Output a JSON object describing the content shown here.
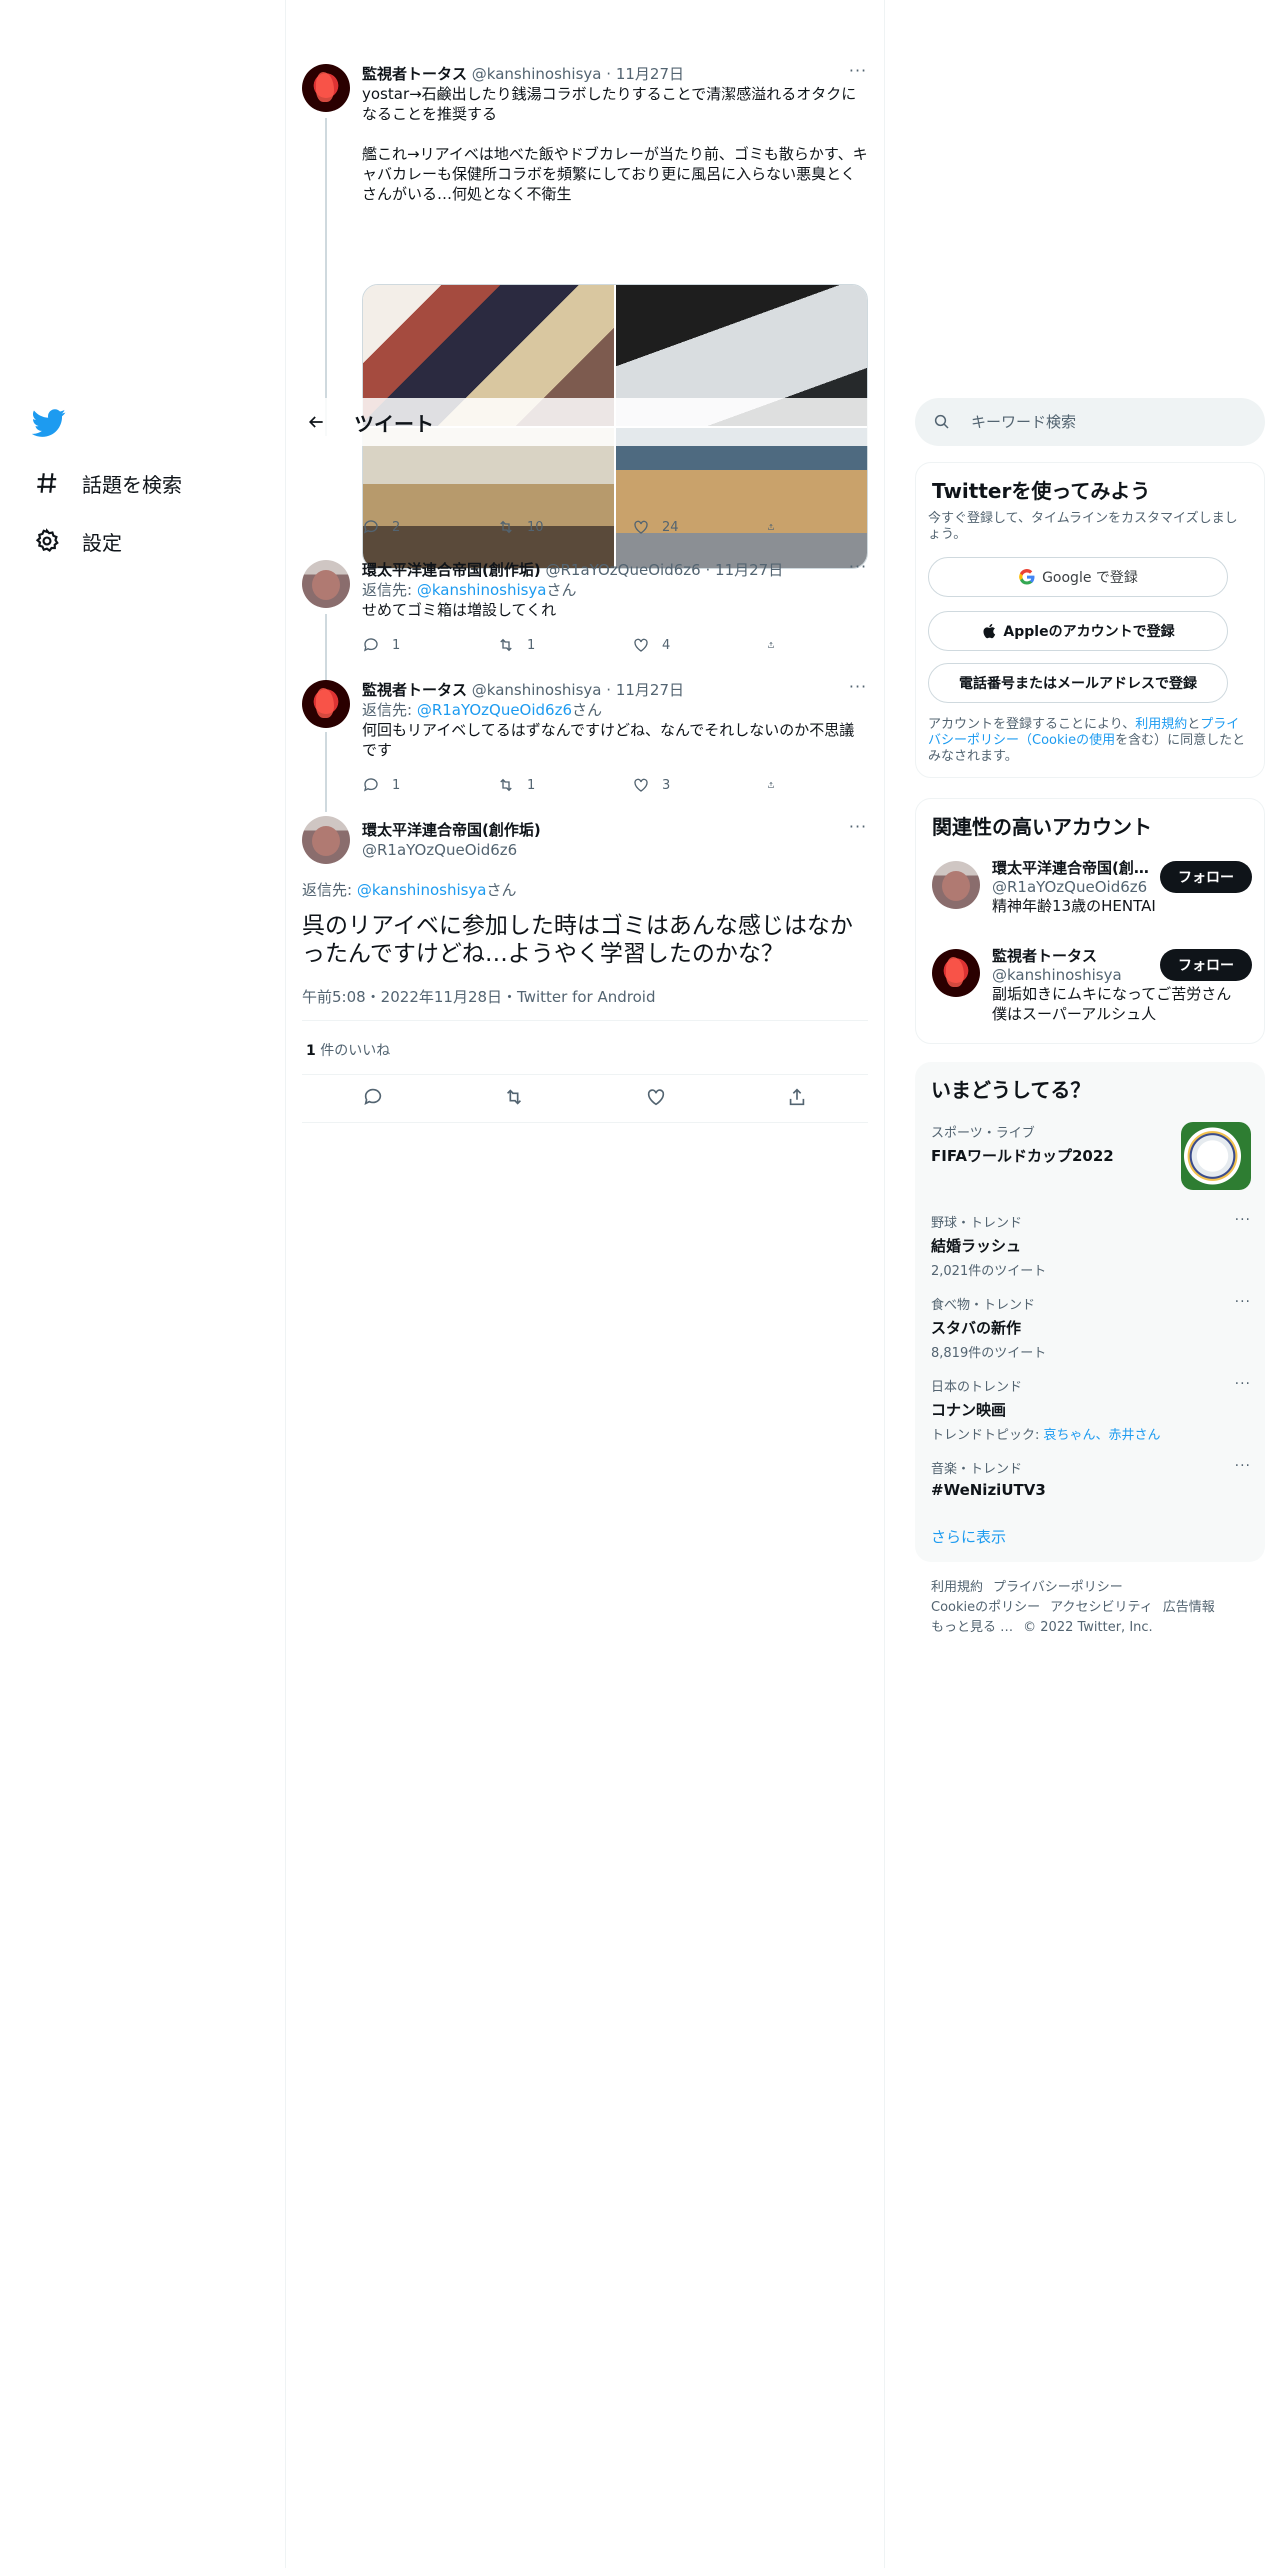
{
  "nav": {
    "logo": "twitter-bird-icon",
    "items": [
      {
        "label": "話題を検索",
        "icon": "hashtag-icon"
      },
      {
        "label": "設定",
        "icon": "gear-icon"
      }
    ]
  },
  "header": {
    "title": "ツイート",
    "back_icon": "arrow-left-icon"
  },
  "tweets": [
    {
      "name": "監視者トータス",
      "handle": "@kanshinoshisya",
      "date": "11月27日",
      "text": "yostar→石鹸出したり銭湯コラボしたりすることで清潔感溢れるオタクになることを推奨する\n\n艦これ→リアイベは地べた飯やドブカレーが当たり前、ゴミも散らかす、キャバカレーも保健所コラボを頻繁にしており更に風呂に入らない悪臭とくさんがいる…何処となく不衛生",
      "replies": "2",
      "retweets": "10",
      "likes": "24"
    },
    {
      "name": "環太平洋連合帝国(創作垢)",
      "handle": "@R1aYOzQueOid6z6",
      "date": "11月27日",
      "reply_prefix": "返信先: ",
      "reply_to": "@kanshinoshisya",
      "reply_suffix": "さん",
      "text": "せめてゴミ箱は増設してくれ",
      "replies": "1",
      "retweets": "1",
      "likes": "4"
    },
    {
      "name": "監視者トータス",
      "handle": "@kanshinoshisya",
      "date": "11月27日",
      "reply_prefix": "返信先: ",
      "reply_to": "@R1aYOzQueOid6z6",
      "reply_suffix": "さん",
      "text": "何回もリアイベしてるはずなんですけどね、なんでそれしないのか不思議です",
      "replies": "1",
      "retweets": "1",
      "likes": "3"
    }
  ],
  "main_tweet": {
    "name": "環太平洋連合帝国(創作垢)",
    "handle": "@R1aYOzQueOid6z6",
    "reply_prefix": "返信先: ",
    "reply_to": "@kanshinoshisya",
    "reply_suffix": "さん",
    "text": "呉のリアイベに参加した時はゴミはあんな感じはなかったんですけどね…ようやく学習したのかな？",
    "timestamp": "午前5:08・2022年11月28日・Twitter for Android",
    "likes_count": "1",
    "likes_label": " 件のいいね"
  },
  "search": {
    "placeholder": "キーワード検索"
  },
  "signup": {
    "title": "Twitterを使ってみよう",
    "subtitle": "今すぐ登録して、タイムラインをカスタマイズしましょう。",
    "google": "Google で登録",
    "apple": "Appleのアカウントで登録",
    "phone": "電話番号またはメールアドレスで登録",
    "terms_pre": "アカウントを登録することにより、",
    "terms_link1": "利用規約",
    "terms_and": "と",
    "terms_link2": "プライバシーポリシー（Cookieの使用",
    "terms_post": "を含む）に同意したとみなされます。"
  },
  "related": {
    "title": "関連性の高いアカウント",
    "follow_label": "フォロー",
    "accounts": [
      {
        "name": "環太平洋連合帝国(創作垢)",
        "handle": "@R1aYOzQueOid6z6",
        "bio": "精神年齢13歳のHENTAI"
      },
      {
        "name": "監視者トータス",
        "handle": "@kanshinoshisya",
        "bio": "副垢如きにムキになってご苦労さん\n僕はスーパーアルシュ人"
      }
    ]
  },
  "trends": {
    "title": "いまどうしてる？",
    "items": [
      {
        "context": "スポーツ・ライブ",
        "name": "FIFAワールドカップ2022",
        "count": ""
      },
      {
        "context": "野球・トレンド",
        "name": "結婚ラッシュ",
        "count": "2,021件のツイート"
      },
      {
        "context": "食べ物・トレンド",
        "name": "スタバの新作",
        "count": "8,819件のツイート"
      },
      {
        "context": "日本のトレンド",
        "name": "コナン映画",
        "topic_prefix": "トレンドトピック: ",
        "topic": "哀ちゃん、赤井さん"
      },
      {
        "context": "音楽・トレンド",
        "name": "#WeNiziUTV3",
        "count": ""
      }
    ],
    "show_more": "さらに表示"
  },
  "footer": {
    "links": [
      "利用規約",
      "プライバシーポリシー",
      "Cookieのポリシー",
      "アクセシビリティ",
      "広告情報",
      "もっと見る …"
    ],
    "copyright": "© 2022 Twitter, Inc."
  },
  "colors": {
    "accent": "#1d9bf0",
    "text": "#0f1419",
    "muted": "#536471",
    "border": "#eff3f4"
  }
}
